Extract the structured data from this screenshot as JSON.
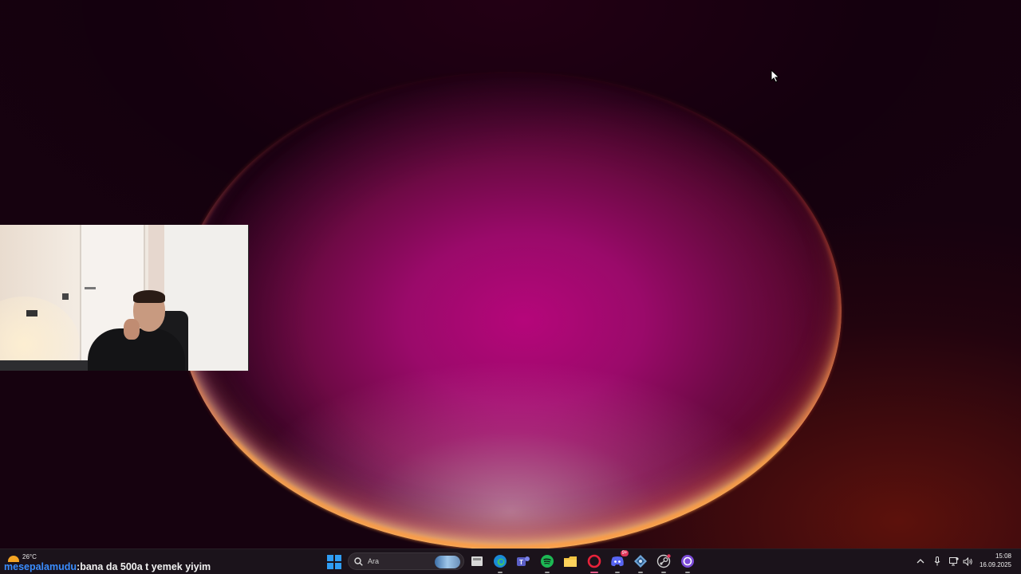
{
  "weather": {
    "temperature": "26°C",
    "icon": "partly-sunny-icon"
  },
  "chat": {
    "username": "mesepalamudu",
    "separator": " : ",
    "message": "bana da 500a t yemek yiyim"
  },
  "taskbar": {
    "search": {
      "placeholder": "Ara"
    },
    "apps": [
      {
        "name": "task-view",
        "icon": "task-view-icon"
      },
      {
        "name": "edge",
        "icon": "edge-icon"
      },
      {
        "name": "teams",
        "icon": "teams-icon"
      },
      {
        "name": "spotify",
        "icon": "spotify-icon"
      },
      {
        "name": "file-explorer",
        "icon": "folder-icon"
      },
      {
        "name": "opera",
        "icon": "opera-icon"
      },
      {
        "name": "discord",
        "icon": "discord-icon",
        "badge": "9+"
      },
      {
        "name": "settings-app",
        "icon": "puzzle-icon"
      },
      {
        "name": "steam",
        "icon": "steam-icon"
      },
      {
        "name": "app-circle",
        "icon": "circle-app-icon"
      }
    ],
    "clock": {
      "time": "15:08",
      "date": "16.09.2025"
    }
  },
  "colors": {
    "chat_username": "#3a8dff",
    "start_blue": "#2f9df4",
    "spotify_green": "#1db954"
  }
}
